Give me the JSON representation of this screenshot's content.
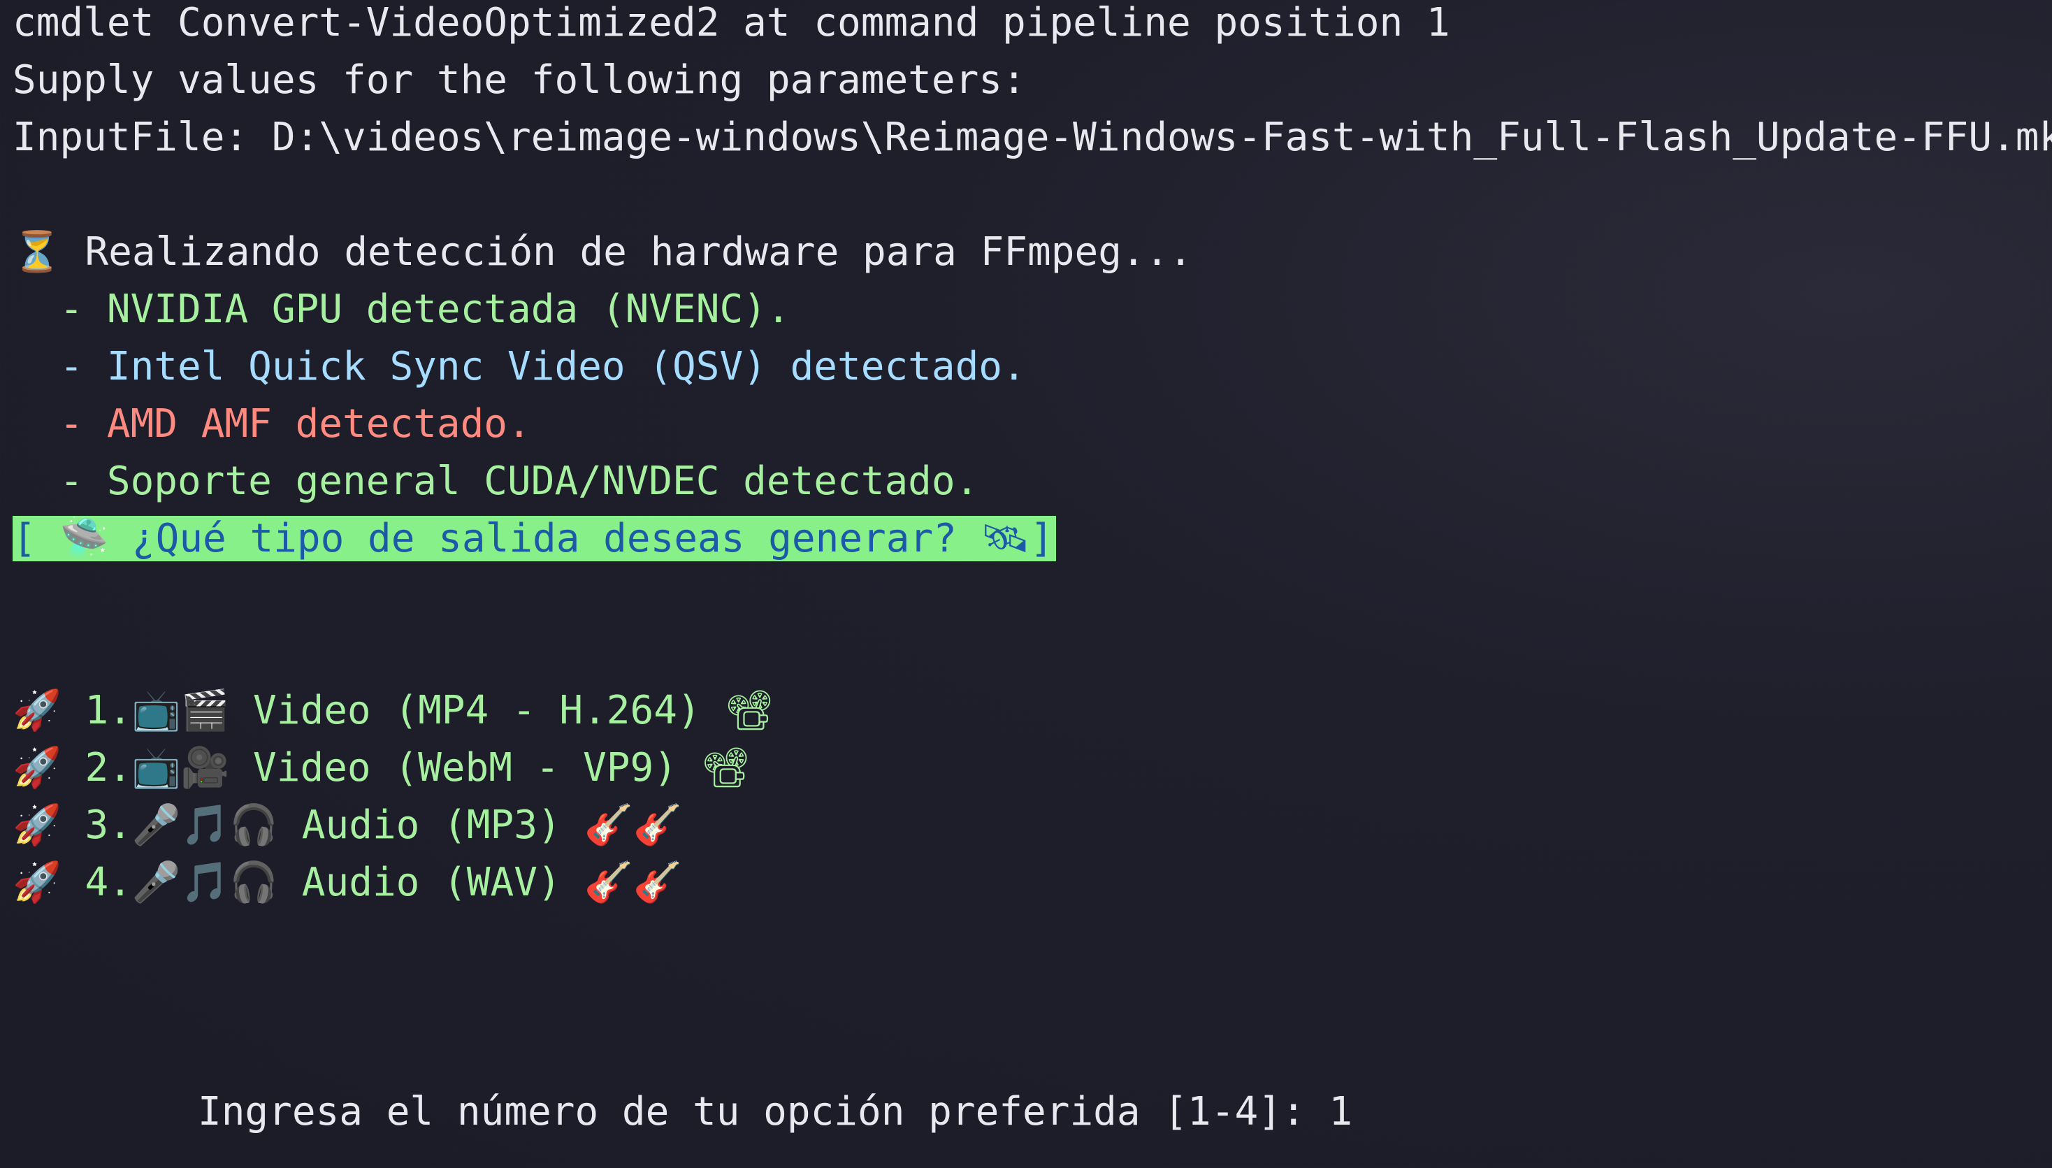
{
  "header": {
    "line1": "cmdlet Convert-VideoOptimized2 at command pipeline position 1",
    "line2": "Supply values for the following parameters:",
    "input_label": "InputFile: ",
    "input_value": "D:\\videos\\reimage-windows\\Reimage-Windows-Fast-with_Full-Flash_Update-FFU.mkv"
  },
  "detection": {
    "icon": "⏳",
    "title": " Realizando detección de hardware para FFmpeg...",
    "items": [
      {
        "text": "  - NVIDIA GPU detectada (NVENC).",
        "color": "#a6f0a0"
      },
      {
        "text": "  - Intel Quick Sync Video (QSV) detectado.",
        "color": "#a6dcff"
      },
      {
        "text": "  - AMD AMF detectado.",
        "color": "#ff8a80"
      },
      {
        "text": "  - Soporte general CUDA/NVDEC detectado.",
        "color": "#a6f0a0"
      }
    ]
  },
  "question": {
    "open": "[ ",
    "icon_left": "🛸",
    "text": " ¿Qué tipo de salida deseas generar? ",
    "icon_right": "🛰",
    "close": "]"
  },
  "options": [
    {
      "prefix": "🚀",
      "number": " 1.",
      "icons": "📺🎬",
      "label": " Video (MP4 - H.264) ",
      "suffix": "📽"
    },
    {
      "prefix": "🚀",
      "number": " 2.",
      "icons": "📺🎥",
      "label": " Video (WebM - VP9) ",
      "suffix": "📽"
    },
    {
      "prefix": "🚀",
      "number": " 3.",
      "icons": "🎤🎵🎧",
      "label": " Audio (MP3) ",
      "suffix": "🎸🎸"
    },
    {
      "prefix": "🚀",
      "number": " 4.",
      "icons": "🎤🎵🎧",
      "label": " Audio (WAV) ",
      "suffix": "🎸🎸"
    }
  ],
  "prompt": {
    "text": "Ingresa el número de tu opción preferida [1-4]: ",
    "value": "1"
  },
  "colors": {
    "background": "#1c1c28",
    "green": "#a6f0a0",
    "blue": "#a6dcff",
    "red": "#ff8a80",
    "highlight_bg": "#88f088",
    "highlight_text": "#1c5aa8"
  }
}
